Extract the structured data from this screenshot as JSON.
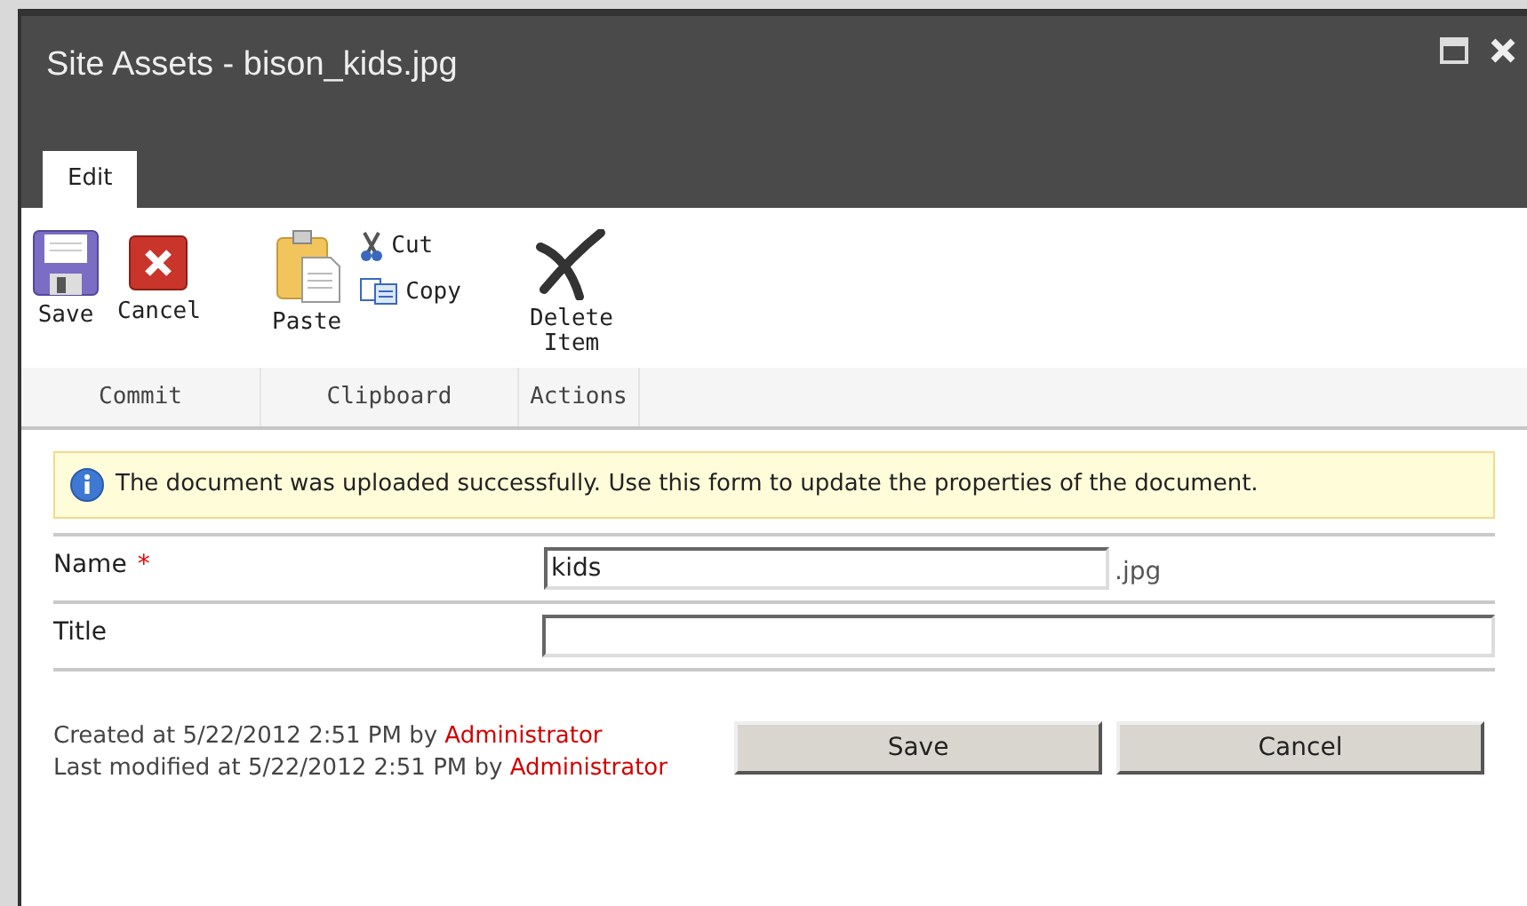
{
  "window": {
    "title": "Site Assets - bison_kids.jpg"
  },
  "tabs": [
    {
      "label": "Edit",
      "selected": true
    }
  ],
  "ribbon": {
    "groups": [
      {
        "label": "Commit",
        "commands": [
          {
            "label": "Save",
            "kind": "save"
          },
          {
            "label": "Cancel",
            "kind": "cancel"
          }
        ]
      },
      {
        "label": "Clipboard",
        "commands": [
          {
            "label": "Paste",
            "kind": "paste"
          },
          {
            "label": "Cut",
            "kind": "cut"
          },
          {
            "label": "Copy",
            "kind": "copy"
          }
        ]
      },
      {
        "label": "Actions",
        "commands": [
          {
            "label": "Delete Item",
            "kind": "delete"
          }
        ]
      }
    ]
  },
  "message": "The document was uploaded successfully. Use this form to update the properties of the document.",
  "fields": [
    {
      "label": "Name",
      "required_mark": "*",
      "value": "kids",
      "suffix": ".jpg"
    },
    {
      "label": "Title"
    }
  ],
  "footer": {
    "created": {
      "text": "Created at 5/22/2012 2:51 PM by",
      "user": "Administrator"
    },
    "modified": {
      "text": "Last modified at 5/22/2012 2:51 PM by",
      "user": "Administrator"
    }
  },
  "buttons": [
    "Save",
    "Cancel"
  ]
}
